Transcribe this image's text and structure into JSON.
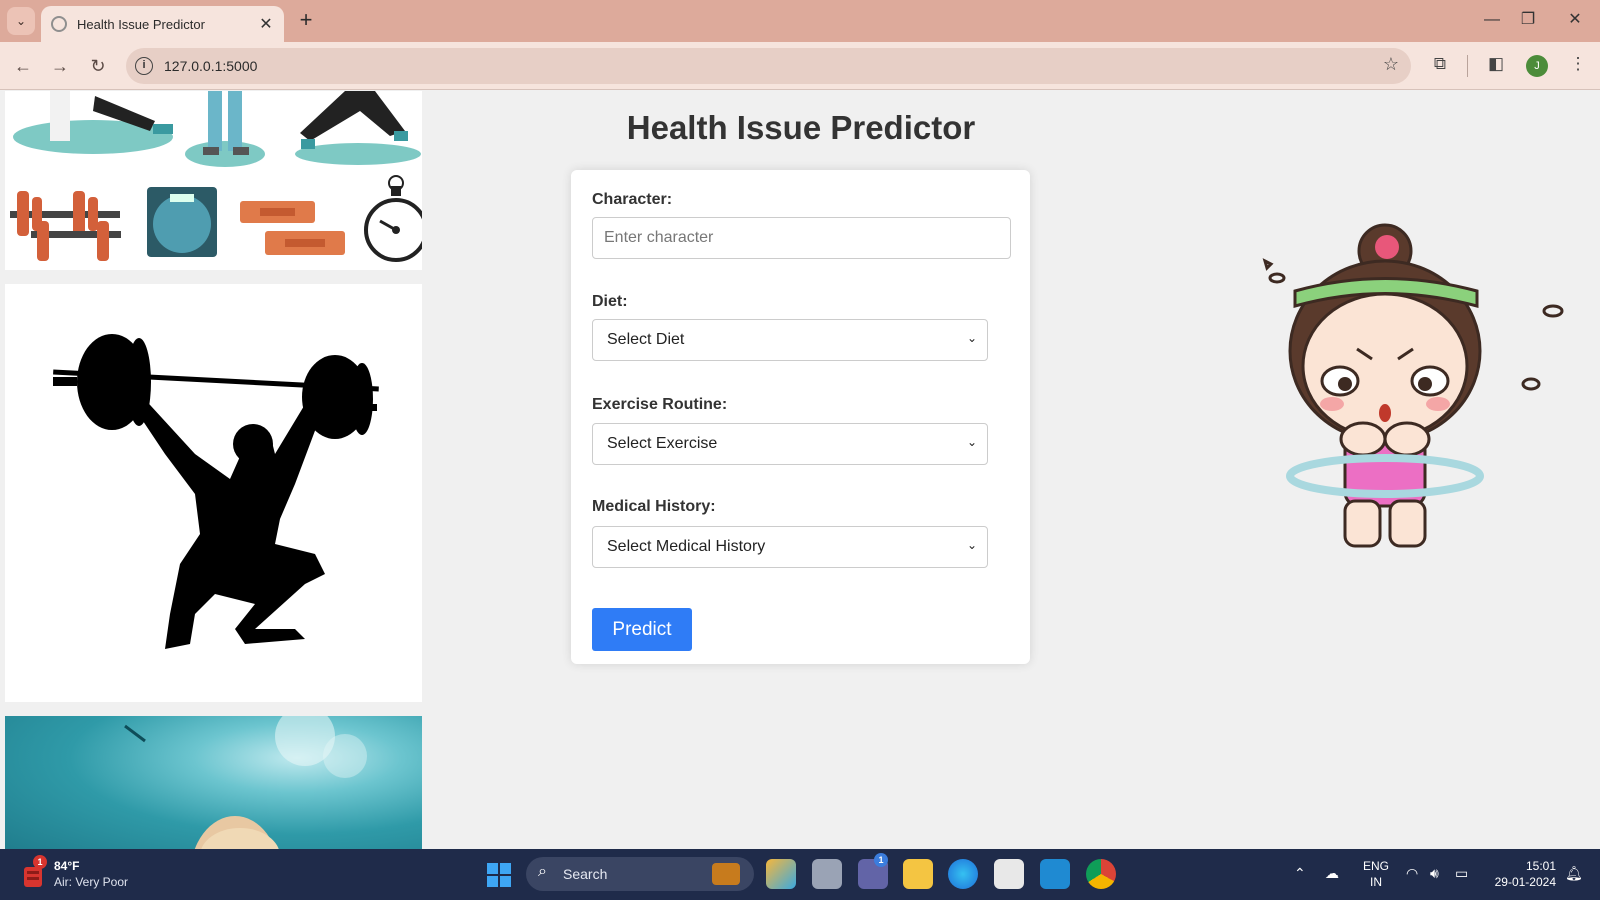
{
  "browser": {
    "tab_title": "Health Issue Predictor",
    "url": "127.0.0.1:5000",
    "profile_initial": "J"
  },
  "page": {
    "title": "Health Issue Predictor",
    "form": {
      "character_label": "Character:",
      "character_placeholder": "Enter character",
      "character_value": "",
      "diet_label": "Diet:",
      "diet_selected": "Select Diet",
      "exercise_label": "Exercise Routine:",
      "exercise_selected": "Select Exercise",
      "history_label": "Medical History:",
      "history_selected": "Select Medical History",
      "predict_label": "Predict"
    }
  },
  "taskbar": {
    "weather_temp": "84°F",
    "weather_air": "Air: Very Poor",
    "weather_badge": "1",
    "search_label": "Search",
    "teams_badge": "1",
    "lang_line1": "ENG",
    "lang_line2": "IN",
    "time": "15:01",
    "date": "29-01-2024"
  },
  "colors": {
    "tabbar": "#ddaa9b",
    "toolbar": "#f6e4dd",
    "predict_button": "#2f7cf6",
    "taskbar": "#1f2b4a"
  }
}
